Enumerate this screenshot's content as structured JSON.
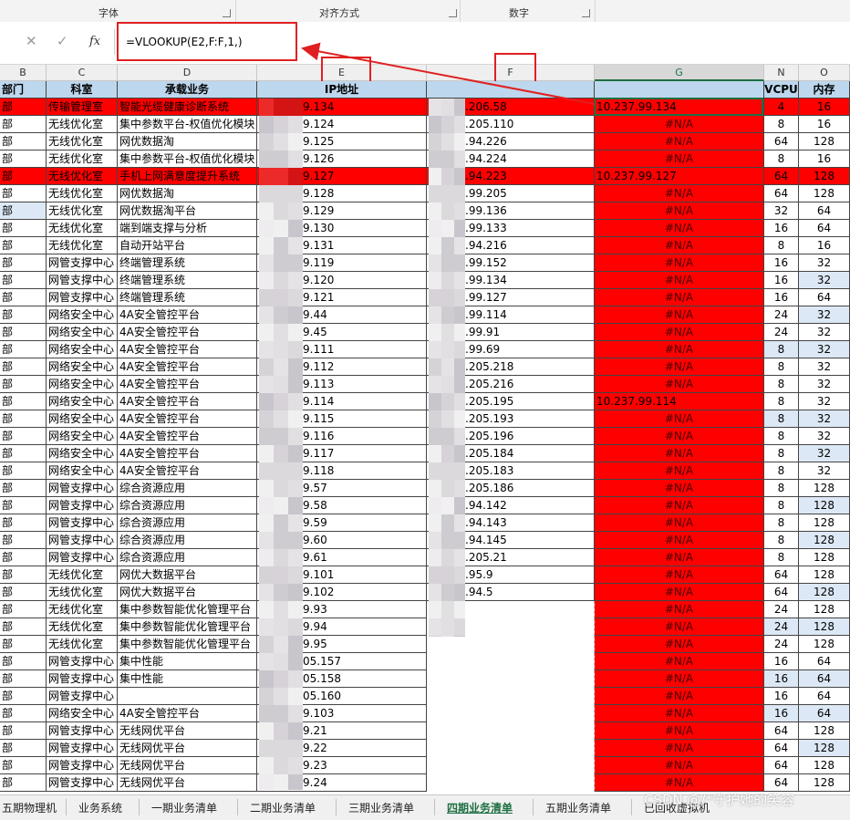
{
  "ribbon": {
    "groups": [
      {
        "label": "字体"
      },
      {
        "label": "对齐方式"
      },
      {
        "label": "数字"
      }
    ]
  },
  "formula_bar": {
    "cancel": "✕",
    "enter": "✓",
    "fx": "fx",
    "formula": "=VLOOKUP(E2,F:F,1,)"
  },
  "columns": [
    "B",
    "C",
    "D",
    "E",
    "F",
    "G",
    "N",
    "O"
  ],
  "headers": {
    "dept": "部门",
    "office": "科室",
    "biz": "承载业务",
    "ip": "IP地址",
    "f": "",
    "g": "",
    "vcpu": "VCPU",
    "mem": "内存"
  },
  "rows": [
    {
      "dept": "部",
      "office": "传输管理室",
      "biz": "智能光缆健康诊断系统",
      "e": "9.134",
      "f": ".206.58",
      "g": "10.237.99.134",
      "vcpu": "4",
      "mem": "16",
      "rowRed": true,
      "gRed": false
    },
    {
      "dept": "部",
      "office": "无线优化室",
      "biz": "集中参数平台-权值优化模块",
      "e": "9.124",
      "f": ".205.110",
      "g": "#N/A",
      "vcpu": "8",
      "mem": "16"
    },
    {
      "dept": "部",
      "office": "无线优化室",
      "biz": "网优数据淘",
      "e": "9.125",
      "f": ".94.226",
      "g": "#N/A",
      "vcpu": "64",
      "mem": "128"
    },
    {
      "dept": "部",
      "office": "无线优化室",
      "biz": "集中参数平台-权值优化模块",
      "e": "9.126",
      "f": ".94.224",
      "g": "#N/A",
      "vcpu": "8",
      "mem": "16"
    },
    {
      "dept": "部",
      "office": "无线优化室",
      "biz": "手机上网满意度提升系统",
      "e": "9.127",
      "f": ".94.223",
      "g": "10.237.99.127",
      "vcpu": "64",
      "mem": "128",
      "rowRed": true
    },
    {
      "dept": "部",
      "office": "无线优化室",
      "biz": "网优数据淘",
      "e": "9.128",
      "f": ".99.205",
      "g": "#N/A",
      "vcpu": "64",
      "mem": "128"
    },
    {
      "dept": "部",
      "office": "无线优化室",
      "biz": "网优数据淘平台",
      "e": "9.129",
      "f": ".99.136",
      "g": "#N/A",
      "vcpu": "32",
      "mem": "64",
      "blueB": true
    },
    {
      "dept": "部",
      "office": "无线优化室",
      "biz": "端到端支撑与分析",
      "e": "9.130",
      "f": ".99.133",
      "g": "#N/A",
      "vcpu": "16",
      "mem": "64"
    },
    {
      "dept": "部",
      "office": "无线优化室",
      "biz": "自动开站平台",
      "e": "9.131",
      "f": ".94.216",
      "g": "#N/A",
      "vcpu": "8",
      "mem": "16"
    },
    {
      "dept": "部",
      "office": "网管支撑中心",
      "biz": "终端管理系统",
      "e": "9.119",
      "f": ".99.152",
      "g": "#N/A",
      "vcpu": "16",
      "mem": "32"
    },
    {
      "dept": "部",
      "office": "网管支撑中心",
      "biz": "终端管理系统",
      "e": "9.120",
      "f": ".99.134",
      "g": "#N/A",
      "vcpu": "16",
      "mem": "32",
      "blueO": true
    },
    {
      "dept": "部",
      "office": "网管支撑中心",
      "biz": "终端管理系统",
      "e": "9.121",
      "f": ".99.127",
      "g": "#N/A",
      "vcpu": "16",
      "mem": "64"
    },
    {
      "dept": "部",
      "office": "网络安全中心",
      "biz": "4A安全管控平台",
      "e": "9.44",
      "f": ".99.114",
      "g": "#N/A",
      "vcpu": "24",
      "mem": "32",
      "blueO": true
    },
    {
      "dept": "部",
      "office": "网络安全中心",
      "biz": "4A安全管控平台",
      "e": "9.45",
      "f": ".99.91",
      "g": "#N/A",
      "vcpu": "24",
      "mem": "32"
    },
    {
      "dept": "部",
      "office": "网络安全中心",
      "biz": "4A安全管控平台",
      "e": "9.111",
      "f": ".99.69",
      "g": "#N/A",
      "vcpu": "8",
      "mem": "32",
      "blueN": true
    },
    {
      "dept": "部",
      "office": "网络安全中心",
      "biz": "4A安全管控平台",
      "e": "9.112",
      "f": ".205.218",
      "g": "#N/A",
      "vcpu": "8",
      "mem": "32"
    },
    {
      "dept": "部",
      "office": "网络安全中心",
      "biz": "4A安全管控平台",
      "e": "9.113",
      "f": ".205.216",
      "g": "#N/A",
      "vcpu": "8",
      "mem": "32"
    },
    {
      "dept": "部",
      "office": "网络安全中心",
      "biz": "4A安全管控平台",
      "e": "9.114",
      "f": ".205.195",
      "g": "10.237.99.114",
      "vcpu": "8",
      "mem": "32",
      "gRedNA": false
    },
    {
      "dept": "部",
      "office": "网络安全中心",
      "biz": "4A安全管控平台",
      "e": "9.115",
      "f": ".205.193",
      "g": "#N/A",
      "vcpu": "8",
      "mem": "32",
      "blueN": true
    },
    {
      "dept": "部",
      "office": "网络安全中心",
      "biz": "4A安全管控平台",
      "e": "9.116",
      "f": ".205.196",
      "g": "#N/A",
      "vcpu": "8",
      "mem": "32"
    },
    {
      "dept": "部",
      "office": "网络安全中心",
      "biz": "4A安全管控平台",
      "e": "9.117",
      "f": ".205.184",
      "g": "#N/A",
      "vcpu": "8",
      "mem": "32",
      "blueO": true
    },
    {
      "dept": "部",
      "office": "网络安全中心",
      "biz": "4A安全管控平台",
      "e": "9.118",
      "f": ".205.183",
      "g": "#N/A",
      "vcpu": "8",
      "mem": "32"
    },
    {
      "dept": "部",
      "office": "网管支撑中心",
      "biz": "综合资源应用",
      "e": "9.57",
      "f": ".205.186",
      "g": "#N/A",
      "vcpu": "8",
      "mem": "128"
    },
    {
      "dept": "部",
      "office": "网管支撑中心",
      "biz": "综合资源应用",
      "e": "9.58",
      "f": ".94.142",
      "g": "#N/A",
      "vcpu": "8",
      "mem": "128",
      "blueO": true
    },
    {
      "dept": "部",
      "office": "网管支撑中心",
      "biz": "综合资源应用",
      "e": "9.59",
      "f": ".94.143",
      "g": "#N/A",
      "vcpu": "8",
      "mem": "128"
    },
    {
      "dept": "部",
      "office": "网管支撑中心",
      "biz": "综合资源应用",
      "e": "9.60",
      "f": ".94.145",
      "g": "#N/A",
      "vcpu": "8",
      "mem": "128",
      "blueO": true
    },
    {
      "dept": "部",
      "office": "网管支撑中心",
      "biz": "综合资源应用",
      "e": "9.61",
      "f": ".205.21",
      "g": "#N/A",
      "vcpu": "8",
      "mem": "128"
    },
    {
      "dept": "部",
      "office": "无线优化室",
      "biz": "网优大数据平台",
      "e": "9.101",
      "f": ".95.9",
      "g": "#N/A",
      "vcpu": "64",
      "mem": "128"
    },
    {
      "dept": "部",
      "office": "无线优化室",
      "biz": "网优大数据平台",
      "e": "9.102",
      "f": ".94.5",
      "g": "#N/A",
      "vcpu": "64",
      "mem": "128",
      "blueO": true
    },
    {
      "dept": "部",
      "office": "无线优化室",
      "biz": "集中参数智能优化管理平台",
      "e": "9.93",
      "f": "",
      "g": "#N/A",
      "vcpu": "24",
      "mem": "128"
    },
    {
      "dept": "部",
      "office": "无线优化室",
      "biz": "集中参数智能优化管理平台",
      "e": "9.94",
      "f": "",
      "g": "#N/A",
      "vcpu": "24",
      "mem": "128",
      "blueN": true
    },
    {
      "dept": "部",
      "office": "无线优化室",
      "biz": "集中参数智能优化管理平台",
      "e": "9.95",
      "f": "",
      "g": "#N/A",
      "vcpu": "24",
      "mem": "128"
    },
    {
      "dept": "部",
      "office": "网管支撑中心",
      "biz": "集中性能",
      "e": "05.157",
      "f": "",
      "g": "#N/A",
      "vcpu": "16",
      "mem": "64"
    },
    {
      "dept": "部",
      "office": "网管支撑中心",
      "biz": "集中性能",
      "e": "05.158",
      "f": "",
      "g": "#N/A",
      "vcpu": "16",
      "mem": "64",
      "blueN": true
    },
    {
      "dept": "部",
      "office": "网管支撑中心",
      "biz": "",
      "e": "05.160",
      "f": "",
      "g": "#N/A",
      "vcpu": "16",
      "mem": "64"
    },
    {
      "dept": "部",
      "office": "网络安全中心",
      "biz": "4A安全管控平台",
      "e": "9.103",
      "f": "",
      "g": "#N/A",
      "vcpu": "16",
      "mem": "64",
      "blueN": true
    },
    {
      "dept": "部",
      "office": "网管支撑中心",
      "biz": "无线网优平台",
      "e": "9.21",
      "f": "",
      "g": "#N/A",
      "vcpu": "64",
      "mem": "128"
    },
    {
      "dept": "部",
      "office": "网管支撑中心",
      "biz": "无线网优平台",
      "e": "9.22",
      "f": "",
      "g": "#N/A",
      "vcpu": "64",
      "mem": "128",
      "blueO": true
    },
    {
      "dept": "部",
      "office": "网管支撑中心",
      "biz": "无线网优平台",
      "e": "9.23",
      "f": "",
      "g": "#N/A",
      "vcpu": "64",
      "mem": "128"
    },
    {
      "dept": "部",
      "office": "网管支撑中心",
      "biz": "无线网优平台",
      "e": "9.24",
      "f": "",
      "g": "#N/A",
      "vcpu": "64",
      "mem": "128"
    }
  ],
  "tabs": [
    "五期物理机",
    "业务系统",
    "一期业务清单",
    "二期业务清单",
    "三期业务清单",
    "四期业务清单",
    "五期业务清单",
    "已回收虚拟机"
  ],
  "active_tab": "四期业务清单",
  "watermark": "CSDN @/*守护她的笑容",
  "colors": {
    "red": "#ff0000",
    "header_blue": "#bdd7ee",
    "excel_green": "#1d6f42"
  }
}
